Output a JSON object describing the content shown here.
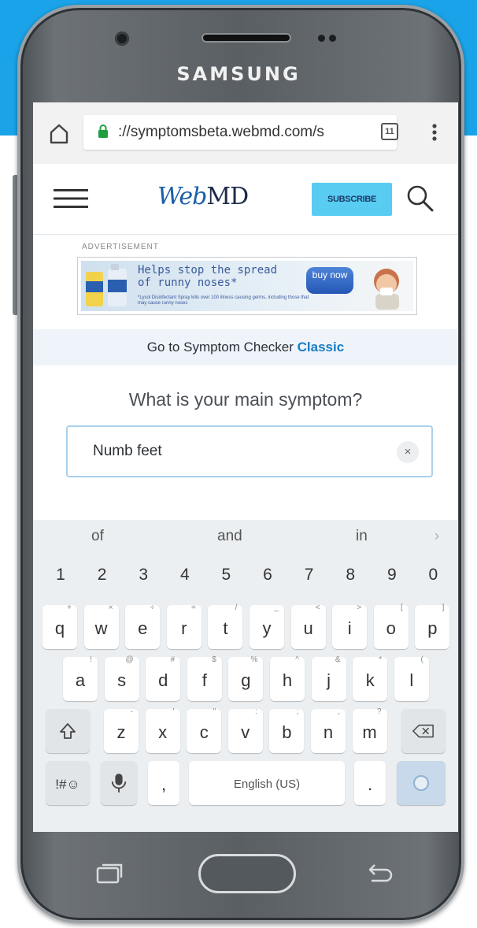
{
  "device": {
    "brand": "SAMSUNG"
  },
  "browser": {
    "url": "://symptomsbeta.webmd.com/s",
    "tab_count": "11"
  },
  "header": {
    "logo_web": "Web",
    "logo_md": "MD",
    "subscribe_label": "SUBSCRIBE"
  },
  "ad": {
    "label": "ADVERTISEMENT",
    "headline_line1": "Helps stop the spread",
    "headline_line2": "of runny noses*",
    "fine_print": "*Lysol Disinfectant Spray kills over 100 illness causing germs, including those that may cause runny noses",
    "button_label": "buy now"
  },
  "classic_link": {
    "prefix": "Go to Symptom Checker ",
    "link": "Classic"
  },
  "question": "What is your main symptom?",
  "symptom_input": {
    "value": "Numb feet",
    "clear": "×"
  },
  "keyboard": {
    "suggestions": [
      "of",
      "and",
      "in"
    ],
    "numbers": [
      "1",
      "2",
      "3",
      "4",
      "5",
      "6",
      "7",
      "8",
      "9",
      "0"
    ],
    "row1": [
      {
        "k": "q",
        "h": "+"
      },
      {
        "k": "w",
        "h": "×"
      },
      {
        "k": "e",
        "h": "÷"
      },
      {
        "k": "r",
        "h": "="
      },
      {
        "k": "t",
        "h": "/"
      },
      {
        "k": "y",
        "h": "_"
      },
      {
        "k": "u",
        "h": "<"
      },
      {
        "k": "i",
        "h": ">"
      },
      {
        "k": "o",
        "h": "["
      },
      {
        "k": "p",
        "h": "]"
      }
    ],
    "row2": [
      {
        "k": "a",
        "h": "!"
      },
      {
        "k": "s",
        "h": "@"
      },
      {
        "k": "d",
        "h": "#"
      },
      {
        "k": "f",
        "h": "$"
      },
      {
        "k": "g",
        "h": "%"
      },
      {
        "k": "h",
        "h": "^"
      },
      {
        "k": "j",
        "h": "&"
      },
      {
        "k": "k",
        "h": "*"
      },
      {
        "k": "l",
        "h": "("
      }
    ],
    "row3": [
      {
        "k": "z",
        "h": "-"
      },
      {
        "k": "x",
        "h": "'"
      },
      {
        "k": "c",
        "h": "\""
      },
      {
        "k": "v",
        "h": ":"
      },
      {
        "k": "b",
        "h": ";"
      },
      {
        "k": "n",
        "h": ","
      },
      {
        "k": "m",
        "h": "?"
      }
    ],
    "symbols_label": "!#☺",
    "comma_label": ",",
    "space_label": "English (US)",
    "period_label": "."
  }
}
